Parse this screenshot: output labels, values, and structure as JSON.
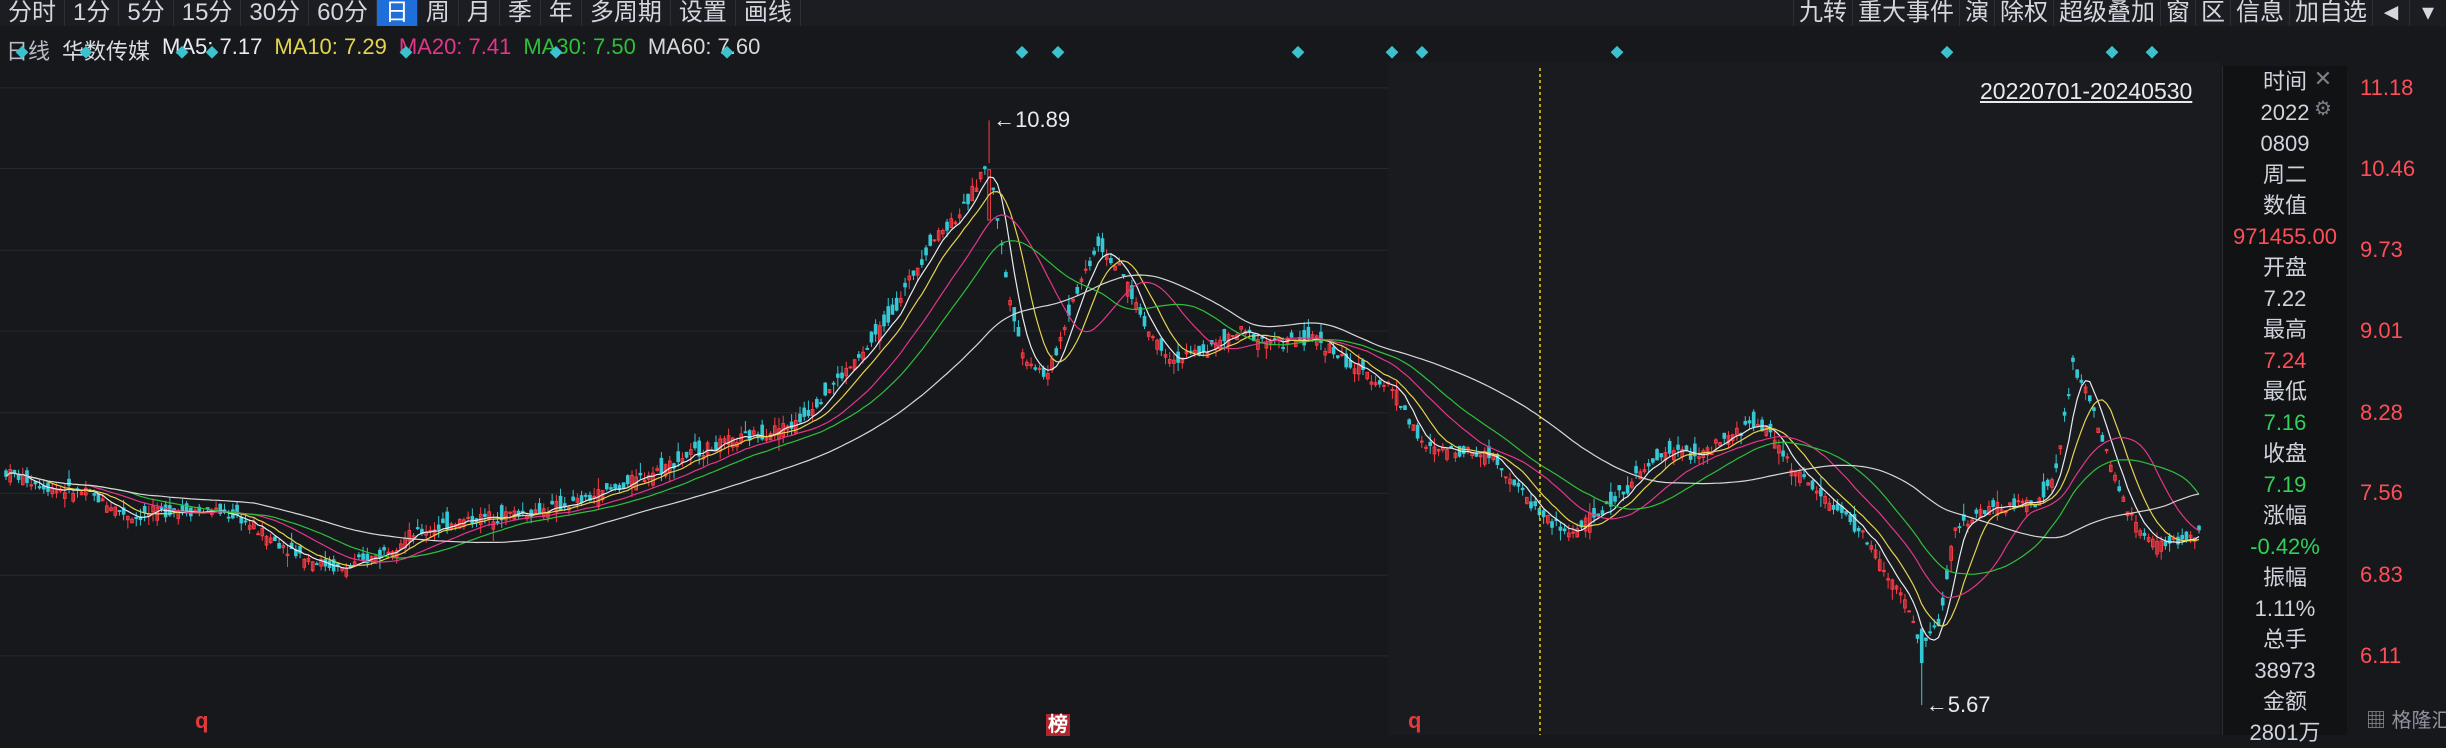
{
  "toolbar": {
    "left": [
      "分时",
      "1分",
      "5分",
      "15分",
      "30分",
      "60分",
      "日",
      "周",
      "月",
      "季",
      "年",
      "多周期",
      "设置",
      "画线"
    ],
    "active": "日",
    "right": [
      "九转",
      "重大事件",
      "演",
      "除权",
      "超级叠加",
      "窗",
      "区",
      "信息",
      "加自选"
    ]
  },
  "legend": {
    "period": "日线",
    "stock_name": "华数传媒",
    "ma5": "MA5: 7.17",
    "ma10": "MA10: 7.29",
    "ma20": "MA20: 7.41",
    "ma30": "MA30: 7.50",
    "ma60": "MA60: 7.60"
  },
  "colors": {
    "up": "#ff3b46",
    "down": "#35c8d4",
    "ma5": "#e9ecf2",
    "ma10": "#e5d44d",
    "ma20": "#e2368a",
    "ma30": "#2fbf3a",
    "ma60": "#d8d8d8",
    "price_axis": "#ff4e57",
    "crosshair": "#e9d21c"
  },
  "range_label": "20220701-20240530",
  "price_axis": [
    "11.18",
    "10.46",
    "9.73",
    "9.01",
    "8.28",
    "7.56",
    "6.83",
    "6.11"
  ],
  "annotations": {
    "high": "10.89",
    "low": "5.67"
  },
  "bottom_marks": [
    {
      "text": "q",
      "kind": "q"
    },
    {
      "text": "榜",
      "kind": "bang"
    },
    {
      "text": "q",
      "kind": "q"
    }
  ],
  "info_panel": {
    "time_label": "时间",
    "year": "2022",
    "date": "0809",
    "weekday": "周二",
    "value_label": "数值",
    "value": "971455.00",
    "open_label": "开盘",
    "open": "7.22",
    "high_label": "最高",
    "high": "7.24",
    "low_label": "最低",
    "low": "7.16",
    "close_label": "收盘",
    "close": "7.19",
    "change_label": "涨幅",
    "change": "-0.42%",
    "amplitude_label": "振幅",
    "amplitude": "1.11%",
    "volume_label": "总手",
    "volume": "38973",
    "amount_label": "金额",
    "amount": "2801万"
  },
  "icons": {
    "close": "close-icon",
    "settings": "gear-icon",
    "collapse": "collapse-left-icon",
    "dropdown": "chevron-down-icon"
  },
  "watermark": "格隆汇",
  "chart_data": {
    "type": "candlestick",
    "title": "华数传媒 日线",
    "x_range": [
      "20220701",
      "20240530"
    ],
    "y_ticks": [
      11.18,
      10.46,
      9.73,
      9.01,
      8.28,
      7.56,
      6.83,
      6.11
    ],
    "ylim": [
      5.6,
      11.25
    ],
    "series_names": [
      "MA5",
      "MA10",
      "MA20",
      "MA30",
      "MA60"
    ],
    "ma_last": {
      "MA5": 7.17,
      "MA10": 7.29,
      "MA20": 7.41,
      "MA30": 7.5,
      "MA60": 7.6
    },
    "annotated_high": 10.89,
    "annotated_low": 5.67,
    "selected_bar": {
      "date": "20220809",
      "open": 7.22,
      "high": 7.24,
      "low": 7.16,
      "close": 7.19,
      "change_pct": -0.42,
      "amplitude_pct": 1.11,
      "volume": 38973,
      "amount": "2801万"
    },
    "close_path": [
      [
        0,
        7.75
      ],
      [
        10,
        7.62
      ],
      [
        20,
        7.55
      ],
      [
        30,
        7.35
      ],
      [
        40,
        7.42
      ],
      [
        50,
        7.4
      ],
      [
        55,
        7.36
      ],
      [
        62,
        7.18
      ],
      [
        72,
        6.98
      ],
      [
        80,
        6.88
      ],
      [
        88,
        7.0
      ],
      [
        96,
        7.18
      ],
      [
        106,
        7.3
      ],
      [
        116,
        7.36
      ],
      [
        126,
        7.4
      ],
      [
        136,
        7.48
      ],
      [
        150,
        7.68
      ],
      [
        164,
        7.93
      ],
      [
        178,
        8.08
      ],
      [
        188,
        8.18
      ],
      [
        196,
        8.5
      ],
      [
        204,
        8.8
      ],
      [
        212,
        9.25
      ],
      [
        220,
        9.8
      ],
      [
        228,
        10.1
      ],
      [
        234,
        10.55
      ],
      [
        238,
        9.5
      ],
      [
        242,
        8.8
      ],
      [
        248,
        8.6
      ],
      [
        254,
        9.3
      ],
      [
        260,
        9.8
      ],
      [
        266,
        9.5
      ],
      [
        272,
        9.0
      ],
      [
        278,
        8.75
      ],
      [
        286,
        8.85
      ],
      [
        294,
        9.0
      ],
      [
        302,
        8.9
      ],
      [
        312,
        8.95
      ],
      [
        320,
        8.7
      ],
      [
        330,
        8.5
      ],
      [
        338,
        7.95
      ],
      [
        346,
        7.95
      ],
      [
        354,
        7.9
      ],
      [
        360,
        7.6
      ],
      [
        366,
        7.35
      ],
      [
        372,
        7.2
      ],
      [
        380,
        7.4
      ],
      [
        388,
        7.7
      ],
      [
        396,
        7.95
      ],
      [
        404,
        7.9
      ],
      [
        410,
        8.05
      ],
      [
        416,
        8.2
      ],
      [
        420,
        8.1
      ],
      [
        426,
        7.75
      ],
      [
        432,
        7.55
      ],
      [
        438,
        7.35
      ],
      [
        444,
        7.1
      ],
      [
        448,
        6.8
      ],
      [
        452,
        6.6
      ],
      [
        456,
        6.2
      ],
      [
        460,
        6.4
      ],
      [
        464,
        7.25
      ],
      [
        470,
        7.4
      ],
      [
        478,
        7.45
      ],
      [
        484,
        7.5
      ],
      [
        488,
        7.75
      ],
      [
        492,
        8.7
      ],
      [
        496,
        8.4
      ],
      [
        500,
        7.9
      ],
      [
        504,
        7.5
      ],
      [
        508,
        7.2
      ],
      [
        512,
        7.1
      ],
      [
        518,
        7.15
      ],
      [
        522,
        7.19
      ]
    ]
  }
}
